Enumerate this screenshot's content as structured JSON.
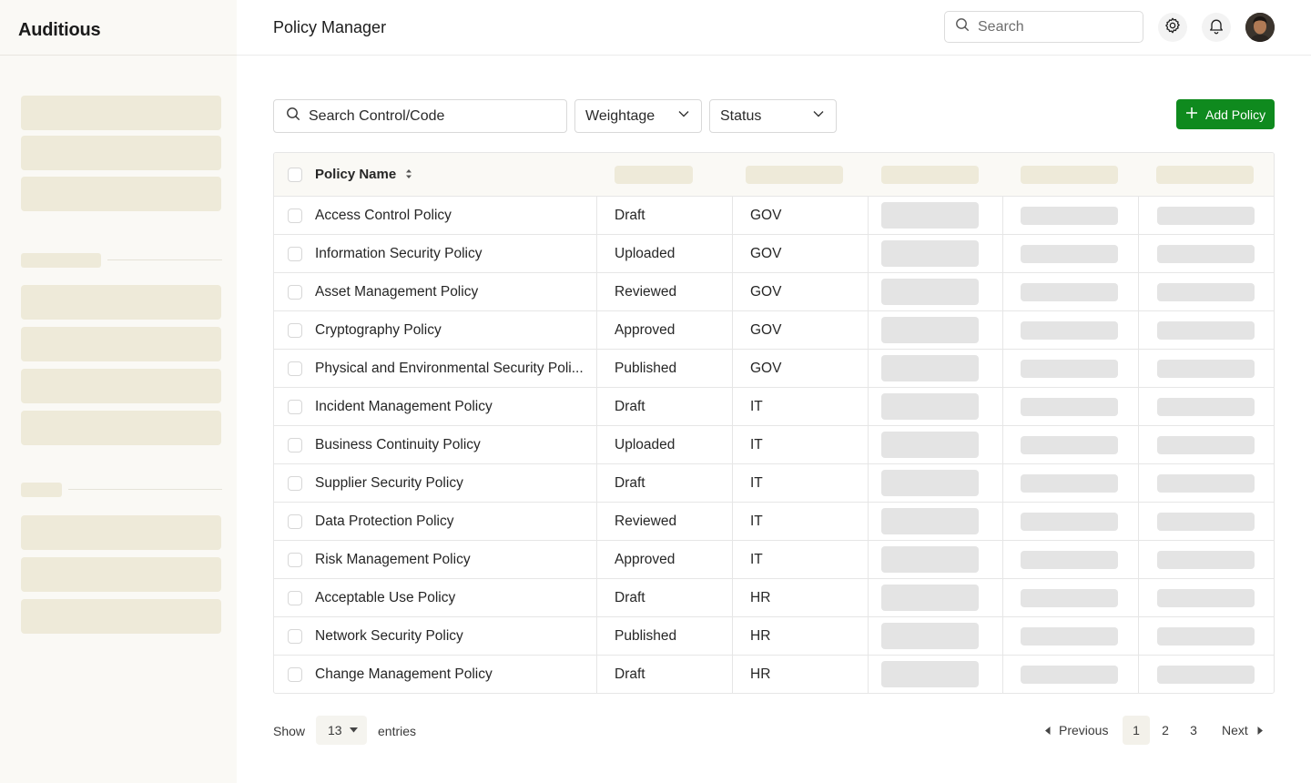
{
  "app": {
    "brand": "Auditious"
  },
  "header": {
    "title": "Policy Manager",
    "search_placeholder": "Search"
  },
  "toolbar": {
    "search_placeholder": "Search Control/Code",
    "weightage_label": "Weightage",
    "status_label": "Status",
    "add_label": "Add Policy"
  },
  "table": {
    "columns": [
      "Policy Name"
    ],
    "rows": [
      {
        "name": "Access Control Policy",
        "status": "Draft",
        "category": "GOV"
      },
      {
        "name": "Information Security Policy",
        "status": "Uploaded",
        "category": "GOV"
      },
      {
        "name": "Asset Management Policy",
        "status": "Reviewed",
        "category": "GOV"
      },
      {
        "name": "Cryptography Policy",
        "status": "Approved",
        "category": "GOV"
      },
      {
        "name": "Physical and Environmental Security Poli...",
        "status": "Published",
        "category": "GOV"
      },
      {
        "name": "Incident Management Policy",
        "status": "Draft",
        "category": "IT"
      },
      {
        "name": "Business Continuity Policy",
        "status": "Uploaded",
        "category": "IT"
      },
      {
        "name": "Supplier Security Policy",
        "status": "Draft",
        "category": "IT"
      },
      {
        "name": "Data Protection Policy",
        "status": "Reviewed",
        "category": "IT"
      },
      {
        "name": "Risk Management Policy",
        "status": "Approved",
        "category": "IT"
      },
      {
        "name": "Acceptable Use Policy",
        "status": "Draft",
        "category": "HR"
      },
      {
        "name": "Network Security Policy",
        "status": "Published",
        "category": "HR"
      },
      {
        "name": "Change Management Policy",
        "status": "Draft",
        "category": "HR"
      }
    ]
  },
  "footer": {
    "show_label": "Show",
    "entries_value": "13",
    "entries_label": "entries",
    "previous_label": "Previous",
    "next_label": "Next",
    "pages": [
      "1",
      "2",
      "3"
    ],
    "current_page": "1"
  },
  "colors": {
    "accent": "#0f8a1e",
    "skeleton": "#eeead9",
    "sidebar_bg": "#faf9f5"
  }
}
